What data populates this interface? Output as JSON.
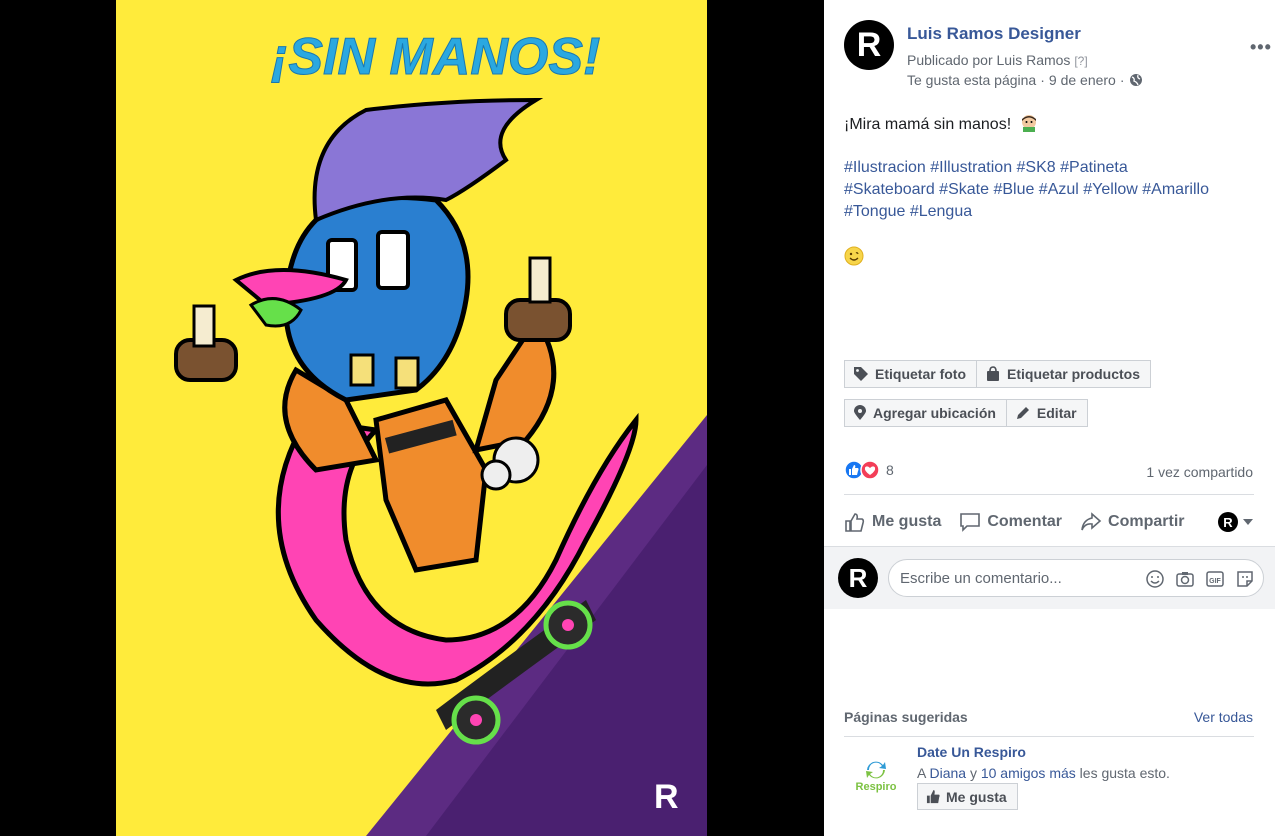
{
  "post": {
    "page_name": "Luis Ramos Designer",
    "published_by_prefix": "Publicado por",
    "published_by_name": "Luis Ramos",
    "published_by_help": "[?]",
    "liked_page_text": "Te gusta esta página",
    "dot": "·",
    "date": "9 de enero",
    "avatar_letter": "R",
    "caption": "¡Mira mamá sin manos!",
    "hashtag_lines": [
      "#Ilustracion #Illustration #SK8 #Patineta",
      "#Skateboard #Skate #Blue #Azul #Yellow #Amarillo",
      "#Tongue #Lengua"
    ]
  },
  "photo": {
    "title_text": "¡SIN MANOS!",
    "watermark": "R",
    "colors": {
      "yellow": "#ffeb3b",
      "purple": "#5c2b82",
      "blue": "#2aa8e0",
      "pink": "#ff44b4",
      "orange": "#f08c2c"
    }
  },
  "photo_tools": {
    "tag_photo": "Etiquetar foto",
    "tag_products": "Etiquetar productos",
    "add_location": "Agregar ubicación",
    "edit": "Editar"
  },
  "stats": {
    "reaction_count": "8",
    "shares": "1 vez compartido"
  },
  "actions": {
    "like": "Me gusta",
    "comment": "Comentar",
    "share": "Compartir"
  },
  "comment": {
    "placeholder": "Escribe un comentario..."
  },
  "suggested": {
    "title": "Páginas sugeridas",
    "see_all": "Ver todas",
    "page_name": "Date Un Respiro",
    "logo_text": "Respiro",
    "desc_prefix": "A",
    "friend": "Diana",
    "conj": "y",
    "friends_more": "10 amigos más",
    "desc_suffix": "les gusta esto.",
    "like_button": "Me gusta"
  },
  "colors": {
    "link": "#385898",
    "text": "#1c1e21",
    "muted": "#606770"
  }
}
